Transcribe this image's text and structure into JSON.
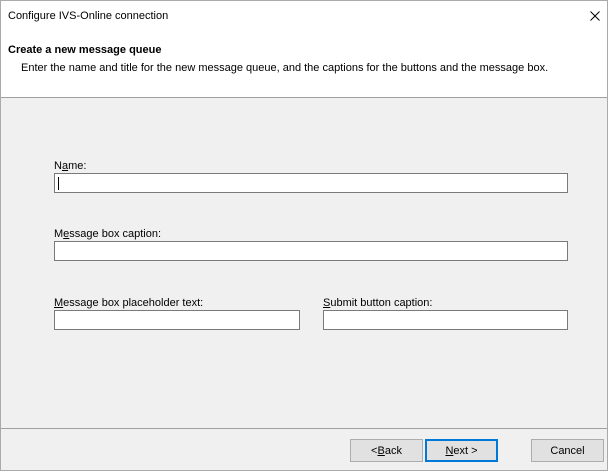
{
  "window": {
    "title": "Configure IVS-Online connection"
  },
  "header": {
    "title": "Create a new message queue",
    "description": "Enter the name and title for the new message queue, and the captions for the buttons and the message box."
  },
  "fields": {
    "name": {
      "label_pre": "N",
      "label_mnemonic": "a",
      "label_post": "me:",
      "value": ""
    },
    "message_box_caption": {
      "label_pre": "M",
      "label_mnemonic": "e",
      "label_post": "ssage box caption:",
      "value": ""
    },
    "placeholder_text": {
      "label_pre": "",
      "label_mnemonic": "M",
      "label_post": "essage box placeholder text:",
      "value": ""
    },
    "submit_caption": {
      "label_pre": "",
      "label_mnemonic": "S",
      "label_post": "ubmit button caption:",
      "value": ""
    }
  },
  "buttons": {
    "back": {
      "pre": "< ",
      "mnemonic": "B",
      "post": "ack"
    },
    "next": {
      "pre": "",
      "mnemonic": "N",
      "post": "ext >"
    },
    "cancel": {
      "label": "Cancel"
    }
  },
  "colors": {
    "accent": "#0078d7",
    "window_bg": "#f0f0f0",
    "header_bg": "#ffffff"
  }
}
